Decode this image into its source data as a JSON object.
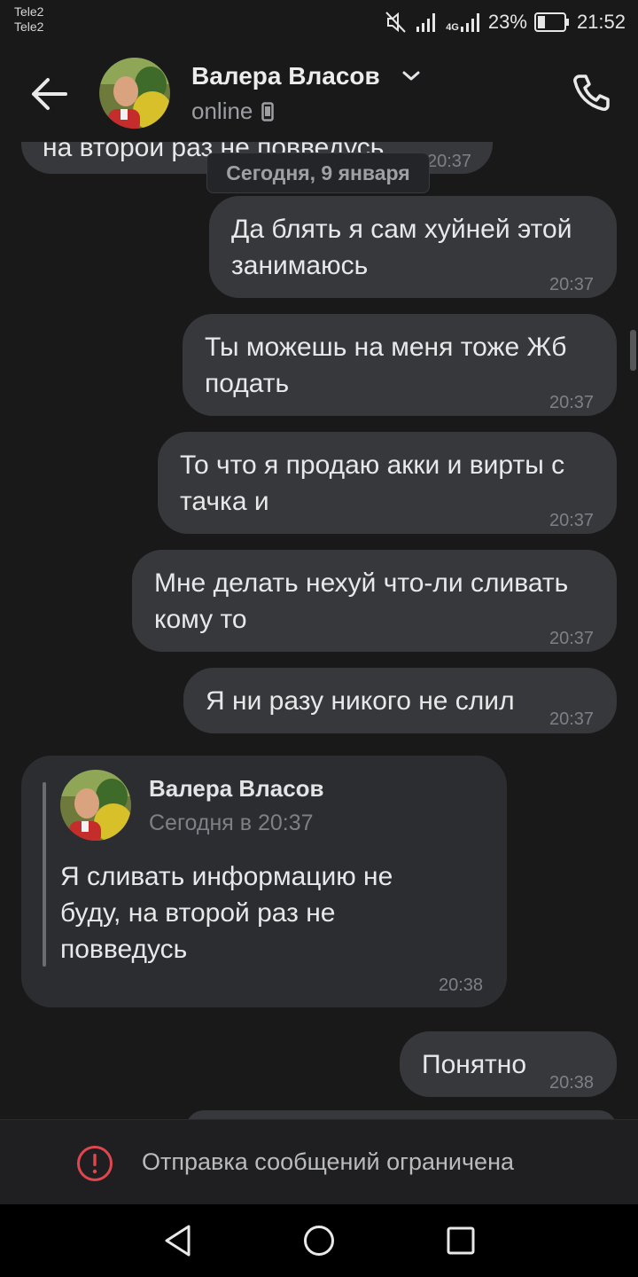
{
  "status_bar": {
    "carrier_1": "Tele2",
    "carrier_2": "Tele2",
    "network": "4G",
    "battery": "23%",
    "time": "21:52",
    "icons": [
      "mute-icon",
      "signal-icon",
      "signal-4g-icon",
      "battery-icon"
    ]
  },
  "header": {
    "name": "Валера Власов",
    "presence": "online",
    "icons": [
      "back-arrow-icon",
      "chevron-down-icon",
      "mobile-device-icon",
      "phone-icon"
    ]
  },
  "chat": {
    "partial_message": {
      "text": "на второй раз не повведусь",
      "time": "20:37"
    },
    "date_separator": "Сегодня, 9 января",
    "outgoing": [
      {
        "text": "Да блять я сам хуйней этой занимаюсь",
        "time": "20:37"
      },
      {
        "text": "Ты можешь на меня тоже Жб подать",
        "time": "20:37"
      },
      {
        "text": "То что я продаю акки и вирты с тачка и",
        "time": "20:37"
      },
      {
        "text": "Мне делать нехуй что-ли сливать кому то",
        "time": "20:37"
      },
      {
        "text": "Я ни разу никого не слил",
        "time": "20:37"
      }
    ],
    "incoming_forward": {
      "author": "Валера Власов",
      "author_time": "Сегодня в 20:37",
      "text": "Я сливать  информацию не буду, на второй раз не повведусь",
      "time": "20:38"
    },
    "last_outgoing": {
      "text": "Понятно",
      "time": "20:38"
    }
  },
  "restriction": {
    "text": "Отправка сообщений ограничена",
    "icon": "alert-circle-icon",
    "color": "#e0464e"
  },
  "nav_bar": {
    "icons": [
      "nav-back-icon",
      "nav-home-icon",
      "nav-recents-icon"
    ]
  },
  "colors": {
    "background": "#19191a",
    "outgoing_bubble": "#37383b",
    "incoming_bubble": "#2c2d30"
  }
}
